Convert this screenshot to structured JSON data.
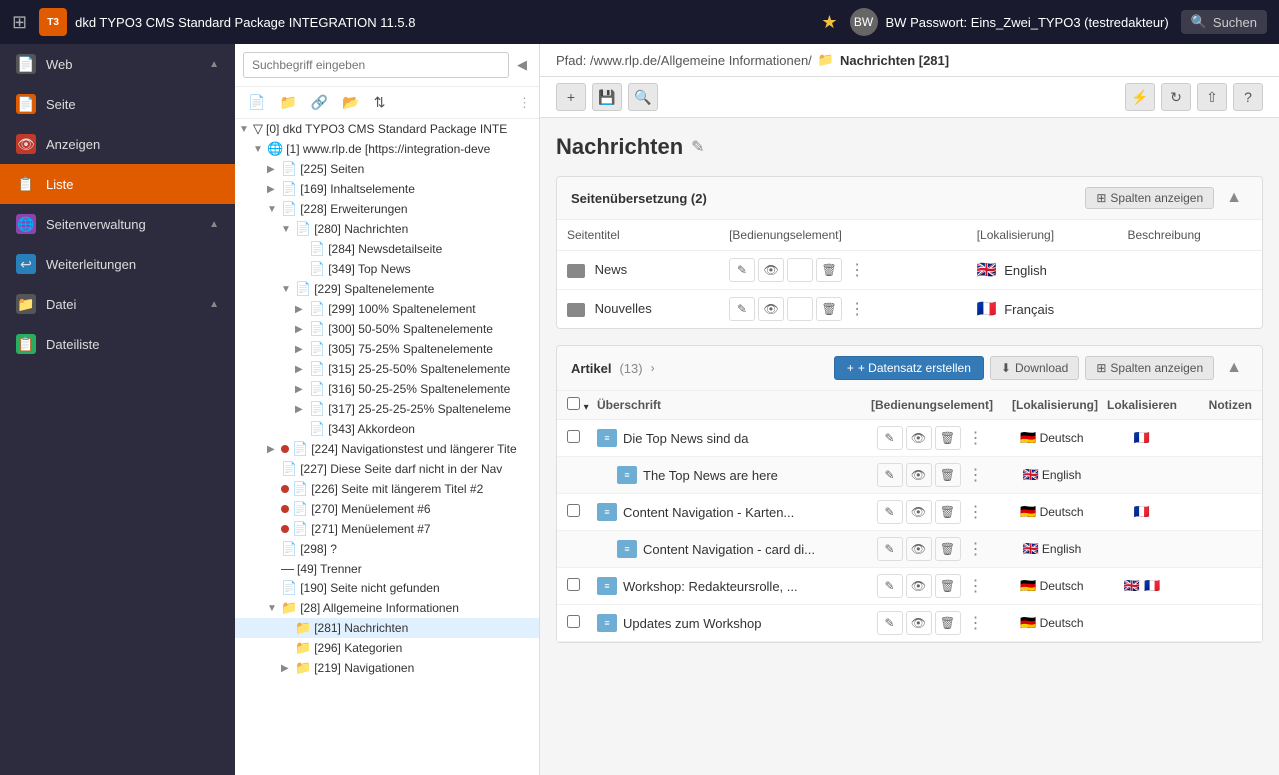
{
  "topbar": {
    "app_title": "dkd TYPO3 CMS Standard Package INTEGRATION",
    "app_version": "11.5.8",
    "user_label": "BW Passwort: Eins_Zwei_TYPO3 (testredakteur)",
    "search_placeholder": "Suchen"
  },
  "sidebar": {
    "items": [
      {
        "id": "web",
        "label": "Web",
        "icon": "📄",
        "expandable": true
      },
      {
        "id": "seite",
        "label": "Seite",
        "icon": "📄"
      },
      {
        "id": "anzeigen",
        "label": "Anzeigen",
        "icon": "👁"
      },
      {
        "id": "liste",
        "label": "Liste",
        "icon": "📋",
        "active": true
      },
      {
        "id": "seitenverwaltung",
        "label": "Seitenverwaltung",
        "icon": "🌐",
        "expandable": true
      },
      {
        "id": "weiterleitungen",
        "label": "Weiterleitungen",
        "icon": "↩"
      },
      {
        "id": "datei",
        "label": "Datei",
        "icon": "📁",
        "expandable": true
      },
      {
        "id": "dateiliste",
        "label": "Dateiliste",
        "icon": "📋"
      }
    ]
  },
  "tree": {
    "search_placeholder": "Suchbegriff eingeben",
    "nodes": [
      {
        "id": "root",
        "label": "[0] dkd TYPO3 CMS Standard Package INTE",
        "level": 0,
        "expanded": true,
        "type": "root"
      },
      {
        "id": "1",
        "label": "[1] www.rlp.de [https://integration-deve",
        "level": 1,
        "expanded": true,
        "type": "globe"
      },
      {
        "id": "225",
        "label": "[225] Seiten",
        "level": 2,
        "type": "page"
      },
      {
        "id": "169",
        "label": "[169] Inhaltselemente",
        "level": 2,
        "type": "page"
      },
      {
        "id": "228",
        "label": "[228] Erweiterungen",
        "level": 2,
        "expanded": true,
        "type": "page"
      },
      {
        "id": "280",
        "label": "[280] Nachrichten",
        "level": 3,
        "expanded": true,
        "type": "page"
      },
      {
        "id": "284",
        "label": "[284] Newsdetailseite",
        "level": 4,
        "type": "page"
      },
      {
        "id": "349",
        "label": "[349] Top News",
        "level": 4,
        "type": "page"
      },
      {
        "id": "229",
        "label": "[229] Spaltenelemente",
        "level": 3,
        "expanded": true,
        "type": "page"
      },
      {
        "id": "299",
        "label": "[299] 100% Spaltenelement",
        "level": 4,
        "type": "page"
      },
      {
        "id": "300",
        "label": "[300] 50-50% Spaltenelemente",
        "level": 4,
        "type": "page"
      },
      {
        "id": "305",
        "label": "[305] 75-25% Spaltenelemente",
        "level": 4,
        "type": "page"
      },
      {
        "id": "315",
        "label": "[315] 25-25-50% Spaltenelemente",
        "level": 4,
        "type": "page"
      },
      {
        "id": "316",
        "label": "[316] 50-25-25% Spaltenelemente",
        "level": 4,
        "type": "page"
      },
      {
        "id": "317",
        "label": "[317] 25-25-25-25% Spalteneleme",
        "level": 4,
        "type": "page"
      },
      {
        "id": "343",
        "label": "[343] Akkordeon",
        "level": 4,
        "type": "page"
      },
      {
        "id": "224",
        "label": "[224] Navigationstest und längerer Tite",
        "level": 2,
        "type": "page-red"
      },
      {
        "id": "227",
        "label": "[227] Diese Seite darf nicht in der Nav",
        "level": 2,
        "type": "page"
      },
      {
        "id": "226",
        "label": "[226] Seite mit längerem Titel #2",
        "level": 2,
        "type": "page-red"
      },
      {
        "id": "270",
        "label": "[270] Menüelement #6",
        "level": 2,
        "type": "page-red"
      },
      {
        "id": "271",
        "label": "[271] Menüelement #7",
        "level": 2,
        "type": "page-red"
      },
      {
        "id": "298",
        "label": "[298] ?",
        "level": 2,
        "type": "page"
      },
      {
        "id": "49",
        "label": "[49] Trenner",
        "level": 2,
        "type": "divider"
      },
      {
        "id": "190",
        "label": "[190] Seite nicht gefunden",
        "level": 2,
        "type": "page"
      },
      {
        "id": "28",
        "label": "[28] Allgemeine Informationen",
        "level": 2,
        "expanded": true,
        "type": "folder"
      },
      {
        "id": "281",
        "label": "[281] Nachrichten",
        "level": 3,
        "type": "folder",
        "selected": true
      },
      {
        "id": "296",
        "label": "[296] Kategorien",
        "level": 3,
        "type": "folder"
      },
      {
        "id": "219",
        "label": "[219] Navigationen",
        "level": 3,
        "type": "folder"
      }
    ]
  },
  "breadcrumb": {
    "path": "Pfad: /www.rlp.de/Allgemeine Informationen/",
    "current": "Nachrichten [281]"
  },
  "page_title": "Nachrichten",
  "seitenübersetzung": {
    "title": "Seitenübersetzung (2)",
    "columns": {
      "seitentitel": "Seitentitel",
      "bedienung": "[Bedienungselement]",
      "lokalisierung": "[Lokalisierung]",
      "beschreibung": "Beschreibung"
    },
    "btn_spalten": "Spalten anzeigen",
    "rows": [
      {
        "title": "News",
        "lang": "English",
        "flag": "🇬🇧"
      },
      {
        "title": "Nouvelles",
        "lang": "Français",
        "flag": "🇫🇷"
      }
    ]
  },
  "artikel": {
    "title": "Artikel",
    "count": "(13)",
    "btn_datensatz": "+ Datensatz erstellen",
    "btn_download": "Download",
    "btn_spalten": "Spalten anzeigen",
    "columns": {
      "uberschrift": "Überschrift",
      "bedienung": "[Bedienungselement]",
      "lokalisierung": "[Lokalisierung]",
      "lokalisieren": "Lokalisieren",
      "notizen": "Notizen"
    },
    "rows": [
      {
        "id": 1,
        "title": "Die Top News sind da",
        "lang_flag": "🇩🇪",
        "lang": "Deutsch",
        "has_fr": true,
        "checkbox": true,
        "sub": false
      },
      {
        "id": 2,
        "title": "The Top News are here",
        "lang_flag": "🇬🇧",
        "lang": "English",
        "has_fr": false,
        "checkbox": false,
        "sub": true
      },
      {
        "id": 3,
        "title": "Content Navigation - Karten...",
        "lang_flag": "🇩🇪",
        "lang": "Deutsch",
        "has_fr": true,
        "checkbox": true,
        "sub": false
      },
      {
        "id": 4,
        "title": "Content Navigation - card di...",
        "lang_flag": "🇬🇧",
        "lang": "English",
        "has_fr": false,
        "checkbox": false,
        "sub": true
      },
      {
        "id": 5,
        "title": "Workshop: Redakteursrolle, ...",
        "lang_flag": "🇩🇪",
        "lang": "Deutsch",
        "has_en": true,
        "has_fr": true,
        "checkbox": true,
        "sub": false
      },
      {
        "id": 6,
        "title": "Updates zum Workshop",
        "lang_flag": "🇩🇪",
        "lang": "Deutsch",
        "has_en": false,
        "has_fr": false,
        "checkbox": true,
        "sub": false
      }
    ]
  }
}
